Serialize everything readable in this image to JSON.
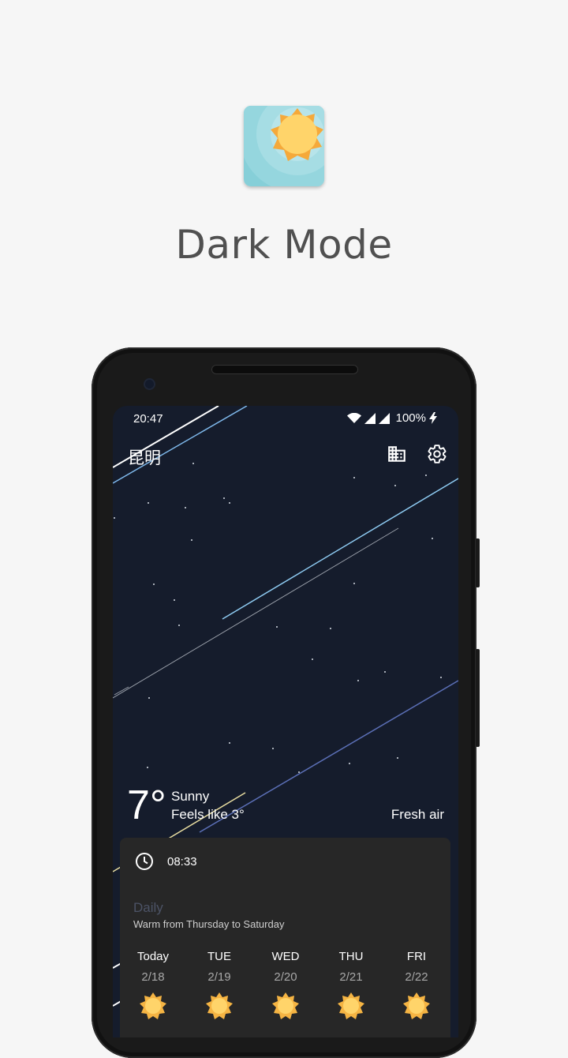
{
  "headline": "Dark Mode",
  "app_icon": "sun-app-icon",
  "status_bar": {
    "time": "20:47",
    "battery": "100%",
    "icons": [
      "wifi-icon",
      "signal-icon",
      "signal-icon",
      "charging-icon"
    ]
  },
  "weather": {
    "city": "昆明",
    "temperature": "7°",
    "condition": "Sunny",
    "feels_like": "Feels like 3°",
    "air_quality": "Fresh air"
  },
  "toolbar_icons": [
    "building-icon",
    "gear-icon"
  ],
  "card": {
    "time": "08:33",
    "daily_title": "Daily",
    "daily_description": "Warm from Thursday to Saturday",
    "days": [
      {
        "name": "Today",
        "date": "2/18",
        "icon": "sunny-icon"
      },
      {
        "name": "TUE",
        "date": "2/19",
        "icon": "sunny-icon"
      },
      {
        "name": "WED",
        "date": "2/20",
        "icon": "sunny-icon"
      },
      {
        "name": "THU",
        "date": "2/21",
        "icon": "sunny-icon"
      },
      {
        "name": "FRI",
        "date": "2/22",
        "icon": "sunny-icon"
      }
    ]
  },
  "colors": {
    "page_background": "#f6f6f6",
    "screen_background": "#151c2c",
    "card_background": "#272727",
    "accent_blue": "#8ecbf2",
    "sun_yellow": "#ffd46a"
  }
}
